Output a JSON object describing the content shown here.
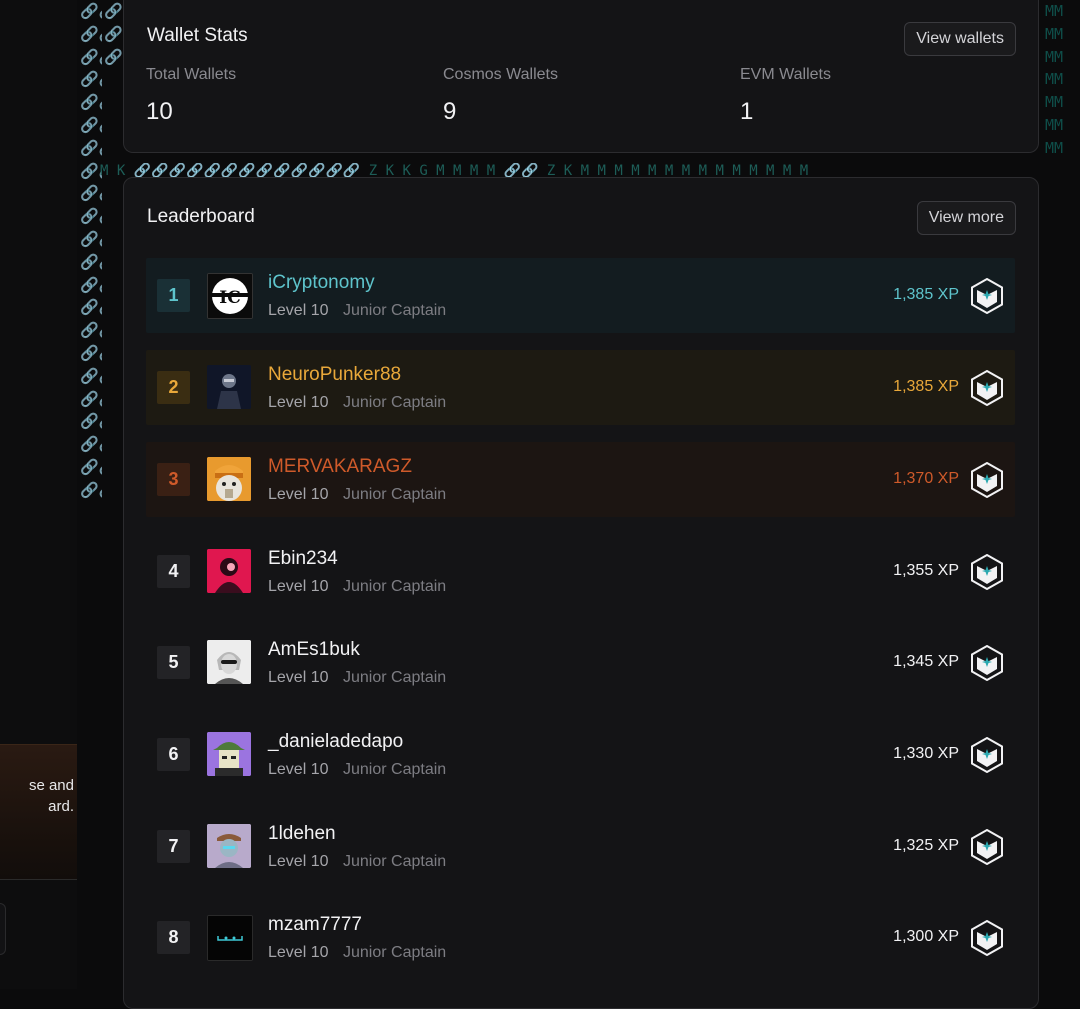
{
  "left_panel": {
    "card_text_line1": "se and",
    "card_text_line2": "ard."
  },
  "pattern": {
    "left_col": "🔗🔗🔗🔗🔗🔗🔗🔗🔗🔗🔗🔗🔗🔗🔗🔗🔗🔗🔗🔗🔗🔗🔗🔗🔗🔗🔗🔗🔗🔗🔗🔗🔗🔗🔗🔗🔗🔗🔗🔗🔗🔗🔗🔗",
    "mid_col": "🔗🔗🔗🔗🔗",
    "right_col": "MMMMMMMMMMMMMM",
    "row": "M K 🔗🔗🔗🔗🔗🔗🔗🔗🔗🔗🔗🔗🔗 Z K K G M M M M 🔗🔗 Z K M M M M M M M M M M M M M M"
  },
  "wallet_stats": {
    "title": "Wallet Stats",
    "view_button": "View wallets",
    "stats": [
      {
        "label": "Total Wallets",
        "value": "10"
      },
      {
        "label": "Cosmos Wallets",
        "value": "9"
      },
      {
        "label": "EVM Wallets",
        "value": "1"
      }
    ]
  },
  "leaderboard": {
    "title": "Leaderboard",
    "view_button": "View more",
    "rows": [
      {
        "rank": "1",
        "name": "iCryptonomy",
        "level": "Level 10",
        "title": "Junior Captain",
        "xp": "1,385 XP"
      },
      {
        "rank": "2",
        "name": "NeuroPunker88",
        "level": "Level 10",
        "title": "Junior Captain",
        "xp": "1,385 XP"
      },
      {
        "rank": "3",
        "name": "MERVAKARAGZ",
        "level": "Level 10",
        "title": "Junior Captain",
        "xp": "1,370 XP"
      },
      {
        "rank": "4",
        "name": "Ebin234",
        "level": "Level 10",
        "title": "Junior Captain",
        "xp": "1,355 XP"
      },
      {
        "rank": "5",
        "name": "AmEs1buk",
        "level": "Level 10",
        "title": "Junior Captain",
        "xp": "1,345 XP"
      },
      {
        "rank": "6",
        "name": "_danieladedapo",
        "level": "Level 10",
        "title": "Junior Captain",
        "xp": "1,330 XP"
      },
      {
        "rank": "7",
        "name": "1ldehen",
        "level": "Level 10",
        "title": "Junior Captain",
        "xp": "1,325 XP"
      },
      {
        "rank": "8",
        "name": "mzam7777",
        "level": "Level 10",
        "title": "Junior Captain",
        "xp": "1,300 XP"
      }
    ]
  },
  "colors": {
    "rank1": "#5ec4cc",
    "rank2": "#e9a83a",
    "rank3": "#cf5a2a",
    "default": "#f2f2f4"
  }
}
